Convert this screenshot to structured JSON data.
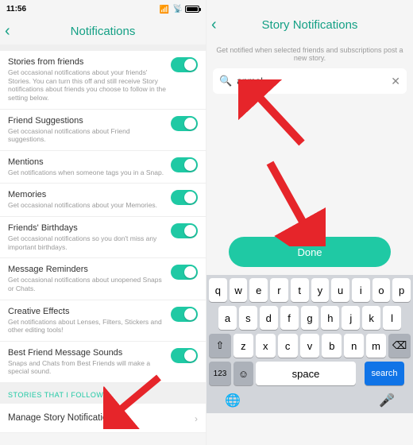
{
  "left": {
    "status_time": "11:56",
    "title": "Notifications",
    "items": [
      {
        "title": "Stories from friends",
        "desc": "Get occasional notifications about your friends' Stories. You can turn this off and still receive Story notifications about friends you choose to follow in the setting below."
      },
      {
        "title": "Friend Suggestions",
        "desc": "Get occasional notifications about Friend suggestions."
      },
      {
        "title": "Mentions",
        "desc": "Get notifications when someone tags you in a Snap."
      },
      {
        "title": "Memories",
        "desc": "Get occasional notifications about your Memories."
      },
      {
        "title": "Friends' Birthdays",
        "desc": "Get occasional notifications so you don't miss any important birthdays."
      },
      {
        "title": "Message Reminders",
        "desc": "Get occasional notifications about unopened Snaps or Chats."
      },
      {
        "title": "Creative Effects",
        "desc": "Get notifications about Lenses, Filters, Stickers and other editing tools!"
      },
      {
        "title": "Best Friend Message Sounds",
        "desc": "Snaps and Chats from Best Friends will make a special sound."
      }
    ],
    "section": "STORIES THAT I FOLLOW",
    "nav_item": "Manage Story Notifications"
  },
  "right": {
    "title": "Story Notifications",
    "subtitle": "Get notified when selected friends and subscriptions post a new story.",
    "search_value": "anmol",
    "done": "Done",
    "kb": {
      "r1": [
        "q",
        "w",
        "e",
        "r",
        "t",
        "y",
        "u",
        "i",
        "o",
        "p"
      ],
      "r2": [
        "a",
        "s",
        "d",
        "f",
        "g",
        "h",
        "j",
        "k",
        "l"
      ],
      "r3": [
        "z",
        "x",
        "c",
        "v",
        "b",
        "n",
        "m"
      ],
      "shift": "⇧",
      "del": "⌫",
      "num": "123",
      "emoji": "☺",
      "space": "space",
      "search": "search",
      "globe": "🌐",
      "mic": "🎤"
    }
  }
}
